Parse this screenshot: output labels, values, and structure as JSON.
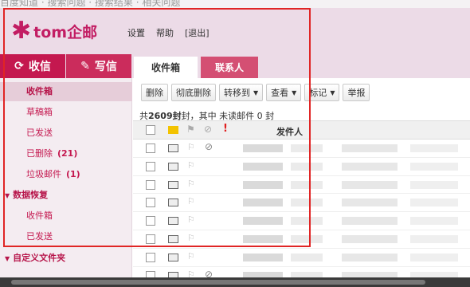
{
  "top_strip": {
    "text": "百度知道 · 搜索问题 · 搜索结果 · 相关问题"
  },
  "header": {
    "logo_text": "tom企邮",
    "links": [
      "设置",
      "帮助",
      "[退出]"
    ]
  },
  "nav": {
    "receive_label": "收信",
    "write_label": "写信",
    "tabs": [
      "收件箱",
      "联系人"
    ]
  },
  "sidebar": {
    "items": [
      {
        "label": "收件箱",
        "count": ""
      },
      {
        "label": "草稿箱",
        "count": ""
      },
      {
        "label": "已发送",
        "count": ""
      },
      {
        "label": "已删除",
        "count": "(21)"
      },
      {
        "label": "垃圾邮件",
        "count": "(1)"
      }
    ],
    "group_recovery": "数据恢复",
    "recovery_items": [
      "收件箱",
      "已发送"
    ],
    "group_custom": "自定义文件夹"
  },
  "toolbar": {
    "delete": "删除",
    "delete_permanent": "彻底删除",
    "move_to": "转移到",
    "view": "查看",
    "mark": "标记",
    "report": "举报"
  },
  "summary": {
    "prefix": "共",
    "total": "2609",
    "middle": "封，其中 未读邮件",
    "unread": "0",
    "suffix": "封"
  },
  "list_header": {
    "sender": "发件人",
    "important_icon": "!"
  },
  "rows": [
    {
      "attachment": true
    },
    {
      "attachment": false
    },
    {
      "attachment": false
    },
    {
      "attachment": false
    },
    {
      "attachment": false
    },
    {
      "attachment": false
    },
    {
      "attachment": false
    },
    {
      "attachment": true
    }
  ],
  "colors": {
    "brand": "#c4184f",
    "highlight_box": "#e02525"
  }
}
